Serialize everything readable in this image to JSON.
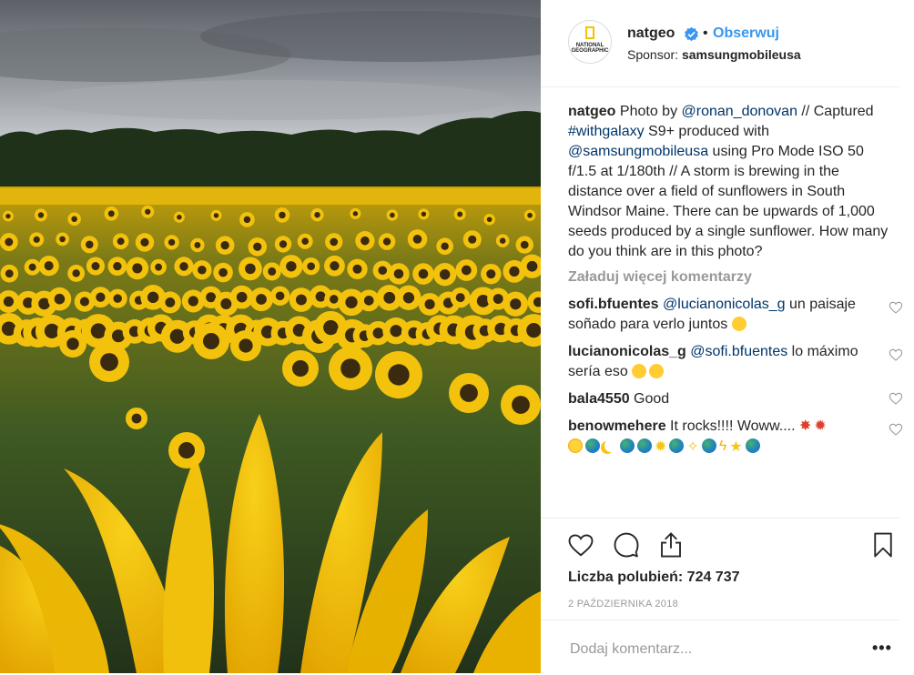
{
  "post": {
    "username": "natgeo",
    "follow_label": "Obserwuj",
    "dot": "•",
    "sponsor_label": "Sponsor:",
    "sponsor_name": "samsungmobileusa",
    "avatar_text": "NATIONAL GEOGRAPHIC"
  },
  "caption": {
    "user": "natgeo",
    "t1": "Photo by ",
    "m1": "@ronan_donovan",
    "t2": " // Captured ",
    "h1": "#withgalaxy",
    "t3": " S9+ produced with ",
    "m2": "@samsungmobileusa",
    "t4": " using Pro Mode ISO 50 f/1.5 at 1/180th // A storm is brewing in the distance over a field of sunflowers in South Windsor Maine. There can be upwards of 1,000 seeds produced by a single sunflower. How many do you think are in this photo?"
  },
  "load_more": "Załaduj więcej komentarzy",
  "comments": [
    {
      "user": "sofi.bfuentes",
      "mention": "@lucianonicolas_g",
      "text": " un paisaje soñado para verlo juntos"
    },
    {
      "user": "lucianonicolas_g",
      "mention": "@sofi.bfuentes",
      "text": " lo máximo sería eso"
    },
    {
      "user": "bala4550",
      "mention": "",
      "text": " Good"
    },
    {
      "user": "benowmehere",
      "mention": "",
      "text": " It rocks!!!! Woww...."
    }
  ],
  "likes_text": "Liczba polubień: 724 737",
  "date": "2 PAŹDZIERNIKA 2018",
  "add_comment_placeholder": "Dodaj komentarz...",
  "more_label": "•••",
  "colors": {
    "link": "#003569",
    "follow": "#3897f0",
    "muted": "#999999"
  },
  "icons": [
    "verified-badge-icon",
    "heart-icon",
    "comment-icon",
    "share-icon",
    "bookmark-icon",
    "small-heart-icon"
  ]
}
